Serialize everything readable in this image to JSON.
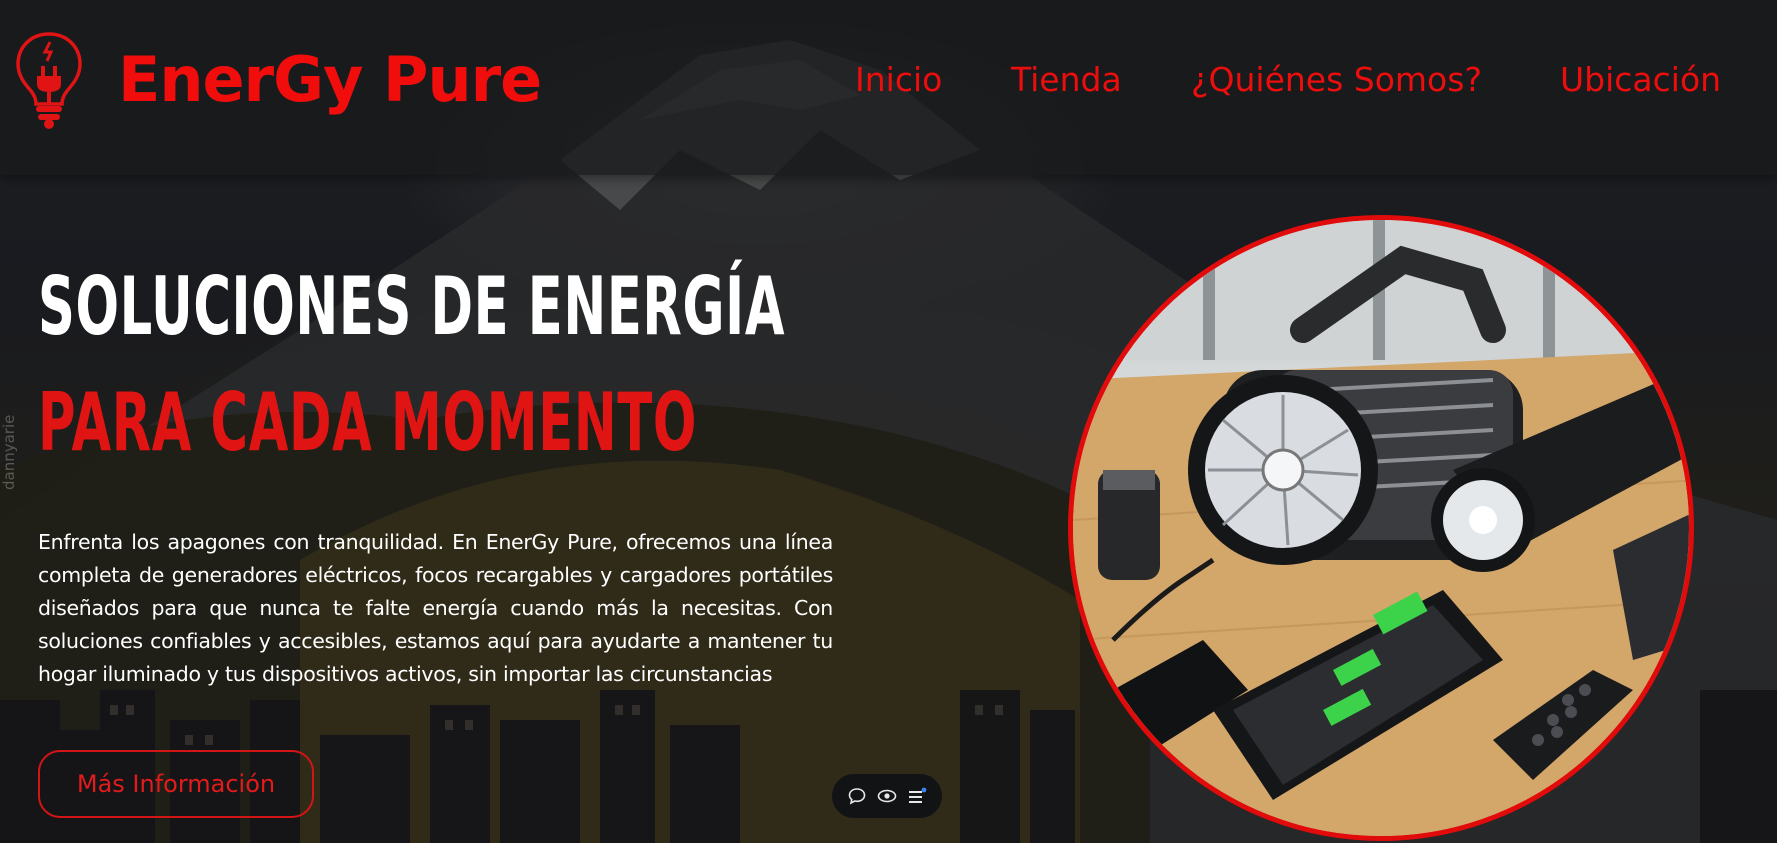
{
  "header": {
    "brand": "EnerGy Pure",
    "logo_icon": "lightbulb-plug-icon",
    "nav": [
      {
        "label": "Inicio"
      },
      {
        "label": "Tienda"
      },
      {
        "label": "¿Quiénes Somos?"
      },
      {
        "label": "Ubicación"
      }
    ]
  },
  "hero": {
    "headline_line1": "SOLUCIONES DE ENERGÍA",
    "headline_line2": "PARA CADA MOMENTO",
    "description": "Enfrenta los apagones con tranquilidad. En EnerGy Pure, ofrecemos una línea completa de generadores eléctricos, focos recargables y cargadores portátiles diseñados para que nunca te falte energía cuando más la necesitas. Con soluciones confiables y accesibles, estamos aquí para ayudarte a mantener tu hogar iluminado y tus dispositivos activos, sin importar las circunstancias",
    "cta_label": "Más Información",
    "image_alt": "Generador portátil, linterna y teléfono cargando"
  },
  "watermark": "dannyarie",
  "toolbar": {
    "icons": [
      "comment-icon",
      "eye-icon",
      "menu-icon"
    ]
  },
  "colors": {
    "accent_red": "#f20d0d",
    "header_bg": "#18191b",
    "text_white": "#ffffff"
  }
}
